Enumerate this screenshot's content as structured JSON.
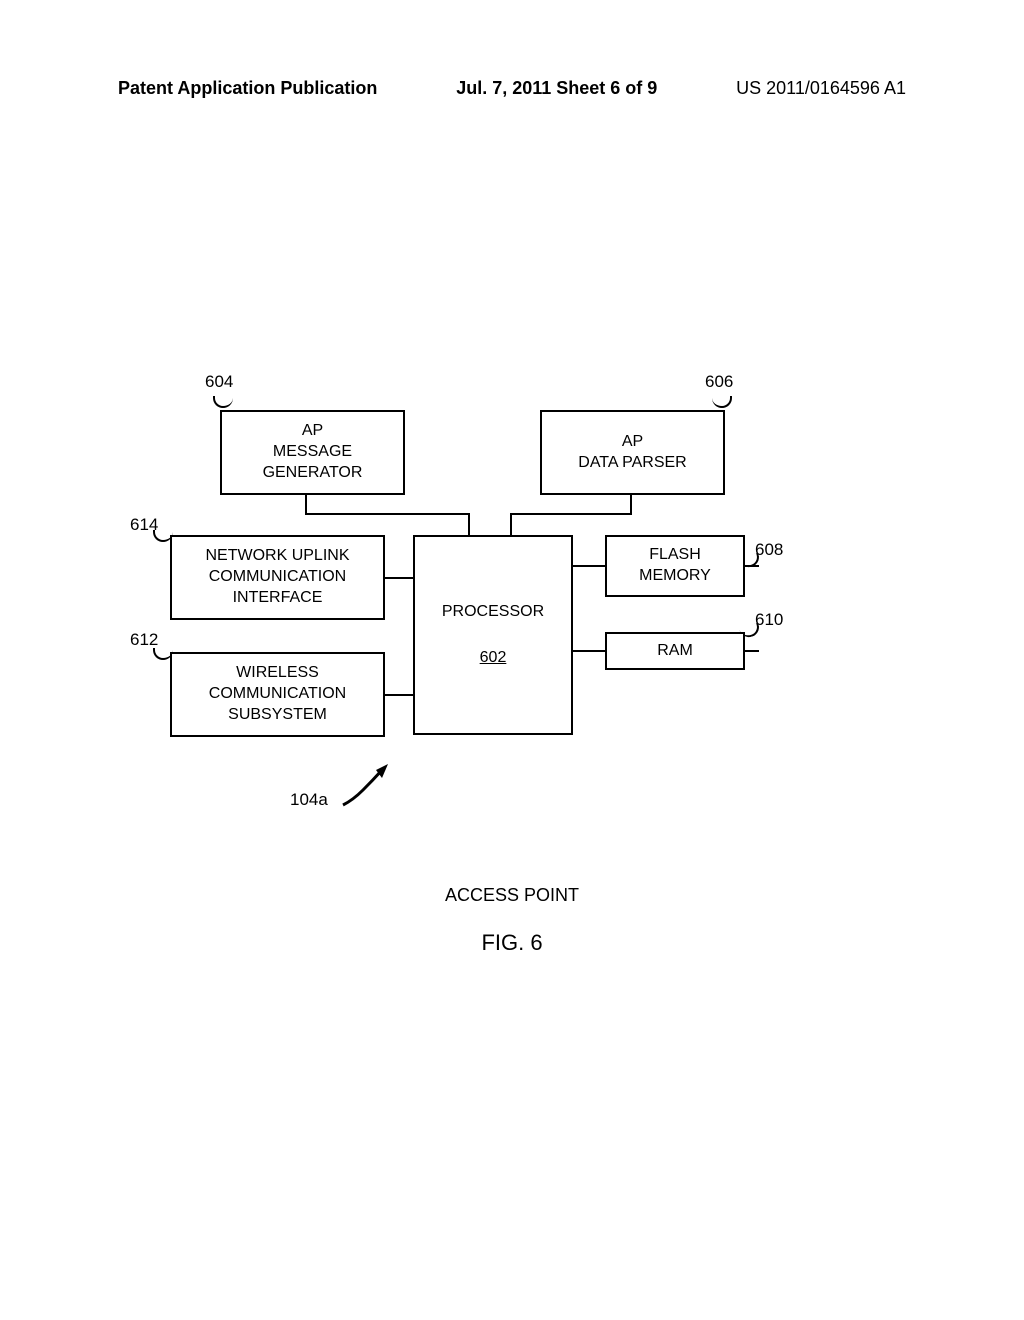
{
  "header": {
    "left": "Patent Application Publication",
    "center": "Jul. 7, 2011  Sheet 6 of 9",
    "right": "US 2011/0164596 A1"
  },
  "boxes": {
    "msg_gen": "AP\nMESSAGE\nGENERATOR",
    "data_parser": "AP\nDATA PARSER",
    "network_uplink": "NETWORK UPLINK\nCOMMUNICATION\nINTERFACE",
    "wireless": "WIRELESS\nCOMMUNICATION\nSUBSYSTEM",
    "processor_label": "PROCESSOR",
    "processor_ref": "602",
    "flash": "FLASH\nMEMORY",
    "ram": "RAM"
  },
  "refs": {
    "r604": "604",
    "r606": "606",
    "r614": "614",
    "r612": "612",
    "r608": "608",
    "r610": "610",
    "r104a": "104a"
  },
  "captions": {
    "access_point": "ACCESS POINT",
    "fig": "FIG. 6"
  }
}
